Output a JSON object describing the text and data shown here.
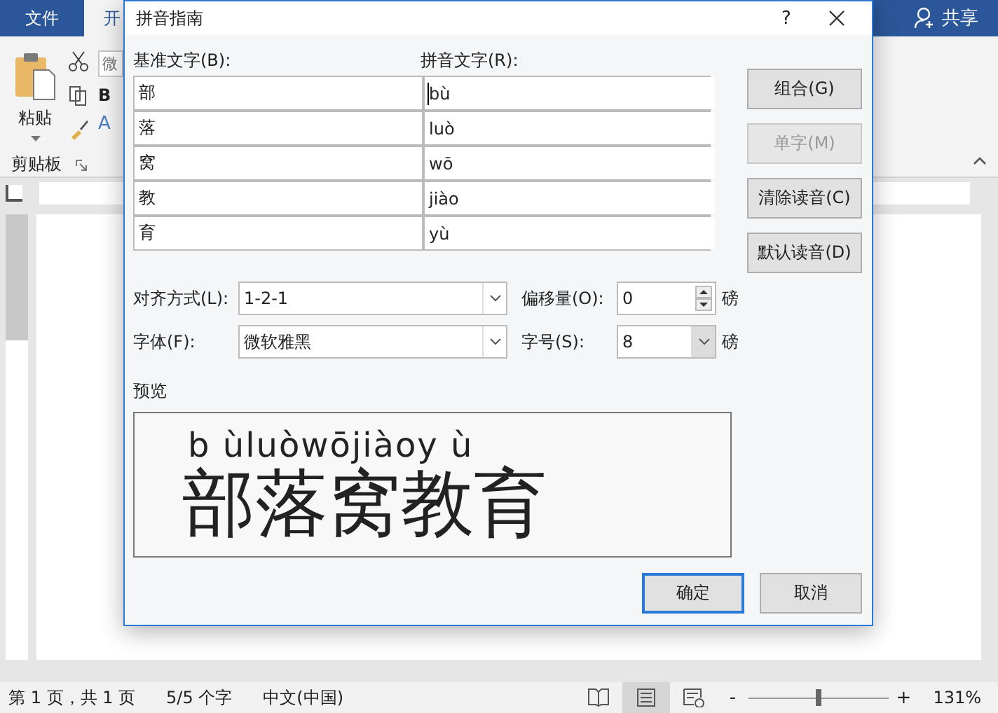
{
  "app": {
    "tabs": [
      {
        "label": "文件",
        "selected": false
      },
      {
        "label": "开",
        "selected": true
      }
    ],
    "share": "共享",
    "clipboard": {
      "paste": "粘贴",
      "group": "剪贴板",
      "font_box": "微",
      "bold": "B",
      "font_color": "A"
    }
  },
  "dialog": {
    "title": "拼音指南",
    "help": "?",
    "base_header": "基准文字(B):",
    "ruby_header": "拼音文字(R):",
    "rows": [
      {
        "base": "部",
        "ruby": "bù",
        "focused": true
      },
      {
        "base": "落",
        "ruby": "luò",
        "focused": false
      },
      {
        "base": "窝",
        "ruby": "wō",
        "focused": false
      },
      {
        "base": "教",
        "ruby": "jiào",
        "focused": false
      },
      {
        "base": "育",
        "ruby": "yù",
        "focused": false
      }
    ],
    "side_buttons": [
      {
        "label": "组合(G)",
        "disabled": false
      },
      {
        "label": "单字(M)",
        "disabled": true
      },
      {
        "label": "清除读音(C)",
        "disabled": false
      },
      {
        "label": "默认读音(D)",
        "disabled": false
      }
    ],
    "alignment": {
      "label": "对齐方式(L):",
      "value": "1-2-1"
    },
    "offset": {
      "label": "偏移量(O):",
      "value": "0",
      "unit": "磅"
    },
    "font": {
      "label": "字体(F):",
      "value": "微软雅黑"
    },
    "size": {
      "label": "字号(S):",
      "value": "8",
      "unit": "磅"
    },
    "preview_label": "预览",
    "preview": {
      "pinyin": "b ùluòwōjiàoy ù",
      "text": "部落窝教育"
    },
    "buttons": [
      {
        "label": "确定",
        "default": true
      },
      {
        "label": "取消",
        "default": false
      }
    ]
  },
  "status_bar": {
    "page": "第 1 页，共 1 页",
    "words": "5/5 个字",
    "language": "中文(中国)",
    "views": [
      {
        "kind": "read",
        "selected": false
      },
      {
        "kind": "print",
        "selected": true
      },
      {
        "kind": "web",
        "selected": false
      }
    ],
    "zoom_out": "-",
    "zoom_in": "+",
    "zoom": {
      "level": 0.5
    },
    "zoom_text": "131%"
  }
}
